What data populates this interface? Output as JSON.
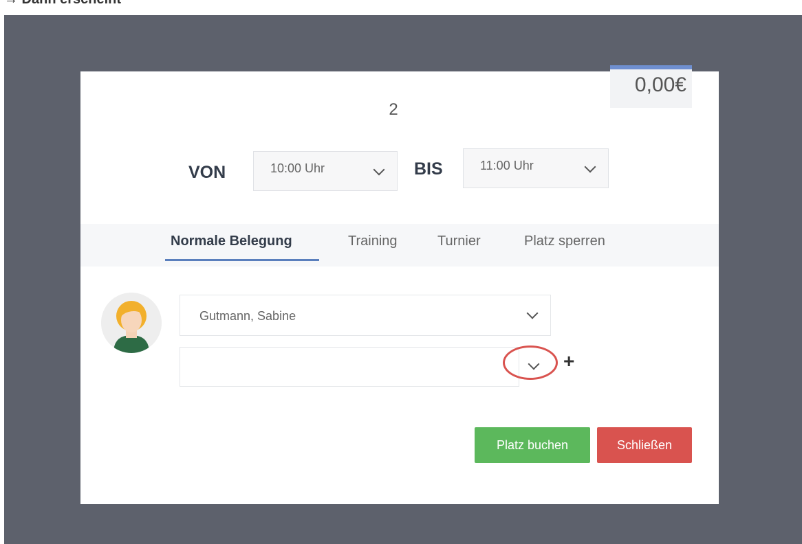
{
  "header": {
    "caption": "→ Dann erscheint"
  },
  "modal": {
    "price": "0,00€",
    "court_number": "2",
    "time": {
      "from_label": "VON",
      "from_value": "10:00 Uhr",
      "to_label": "BIS",
      "to_value": "11:00 Uhr"
    },
    "tabs": [
      {
        "label": "Normale Belegung",
        "active": true
      },
      {
        "label": "Training",
        "active": false
      },
      {
        "label": "Turnier",
        "active": false
      },
      {
        "label": "Platz sperren",
        "active": false
      }
    ],
    "players": {
      "player1_value": "Gutmann, Sabine",
      "player2_value": ""
    },
    "buttons": {
      "book": "Platz buchen",
      "close": "Schließen"
    }
  },
  "colors": {
    "backdrop": "#5d616c",
    "accent": "#5a7fbd",
    "book": "#5cb85c",
    "close": "#d9534f",
    "highlight_circle": "#d9534f"
  },
  "icons": [
    "chevron-down-icon",
    "plus-icon",
    "avatar-icon"
  ]
}
